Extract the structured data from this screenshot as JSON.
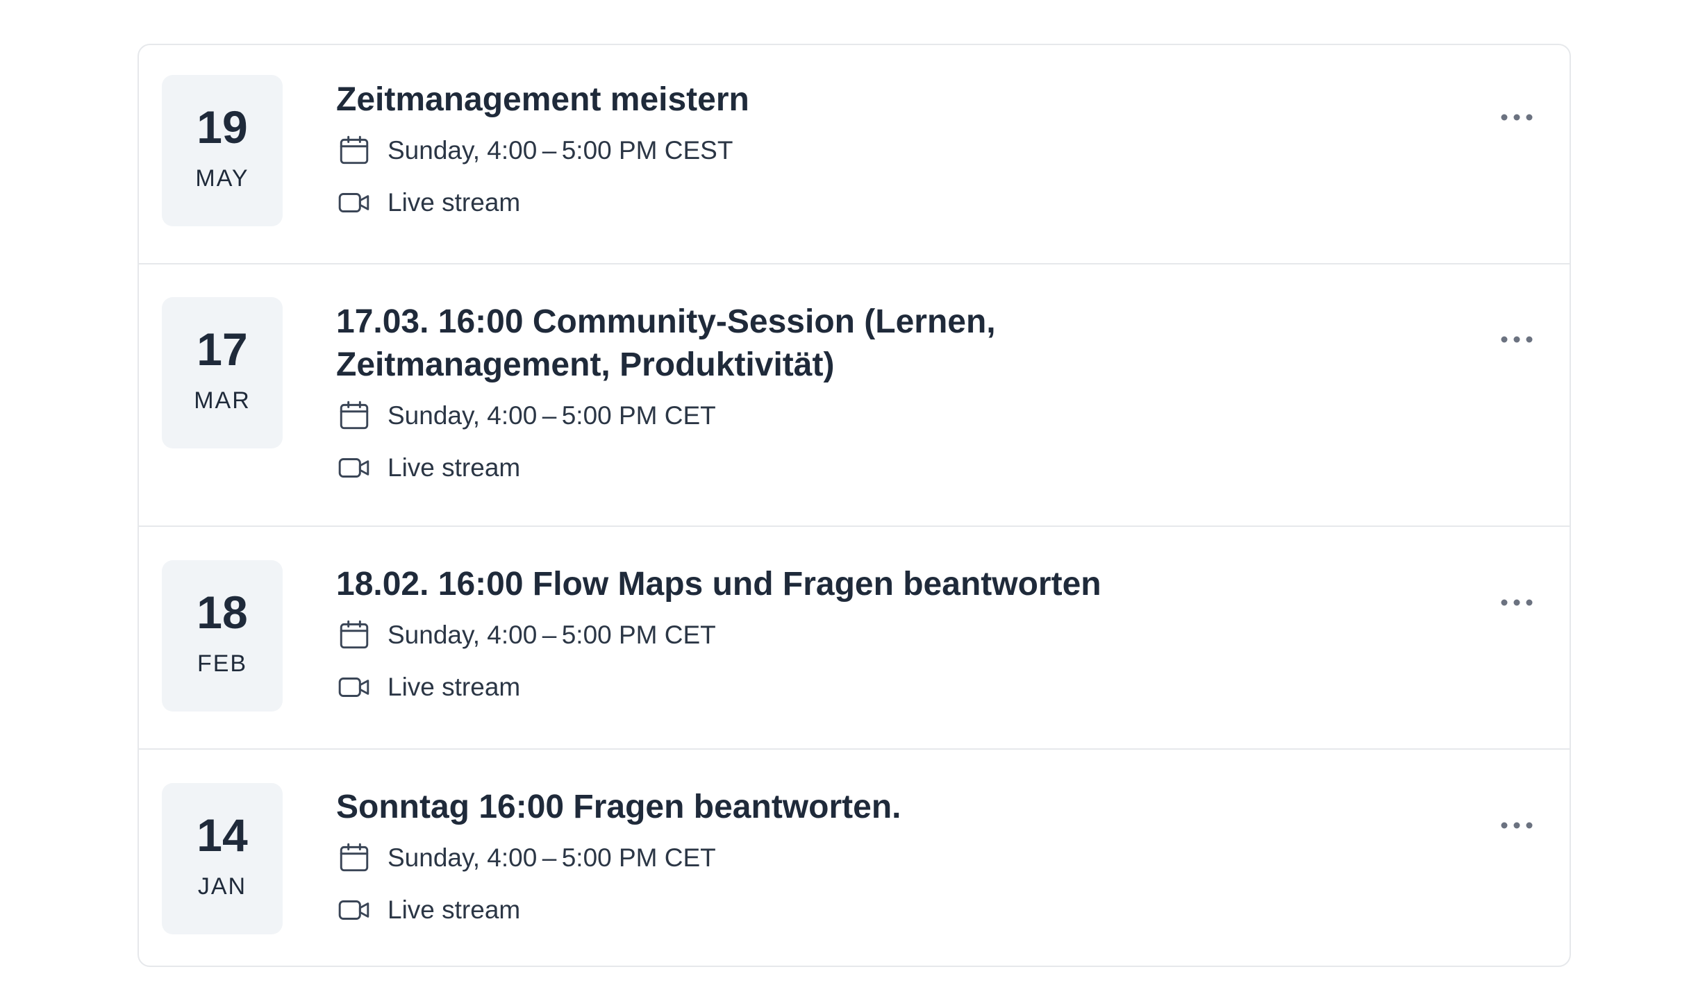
{
  "events": [
    {
      "day": "19",
      "month": "MAY",
      "title": "Zeitmanagement meistern",
      "time": "Sunday, 4:00 – 5:00 PM CEST",
      "location": "Live stream"
    },
    {
      "day": "17",
      "month": "MAR",
      "title": "17.03. 16:00 Community-Session (Lernen, Zeitmanagement, Produktivität)",
      "title_line1": "17.03. 16:00 Community-Session (Lernen,",
      "title_line2": "Zeitmanagement, Produktivität)",
      "time": "Sunday, 4:00 – 5:00 PM CET",
      "location": "Live stream"
    },
    {
      "day": "18",
      "month": "FEB",
      "title": "18.02. 16:00 Flow Maps und Fragen beantworten",
      "time": "Sunday, 4:00 – 5:00 PM CET",
      "location": "Live stream"
    },
    {
      "day": "14",
      "month": "JAN",
      "title": "Sonntag 16:00 Fragen beantworten.",
      "time": "Sunday, 4:00 – 5:00 PM CET",
      "location": "Live stream"
    }
  ],
  "icons": {
    "time": "calendar-icon",
    "location": "video-camera-icon",
    "menu": "more-options-icon"
  },
  "colors": {
    "text": "#1f2a3a",
    "badge_bg": "#f1f4f7",
    "border": "#e6e8eb",
    "icon": "#3a4556",
    "dots": "#6b7280"
  }
}
